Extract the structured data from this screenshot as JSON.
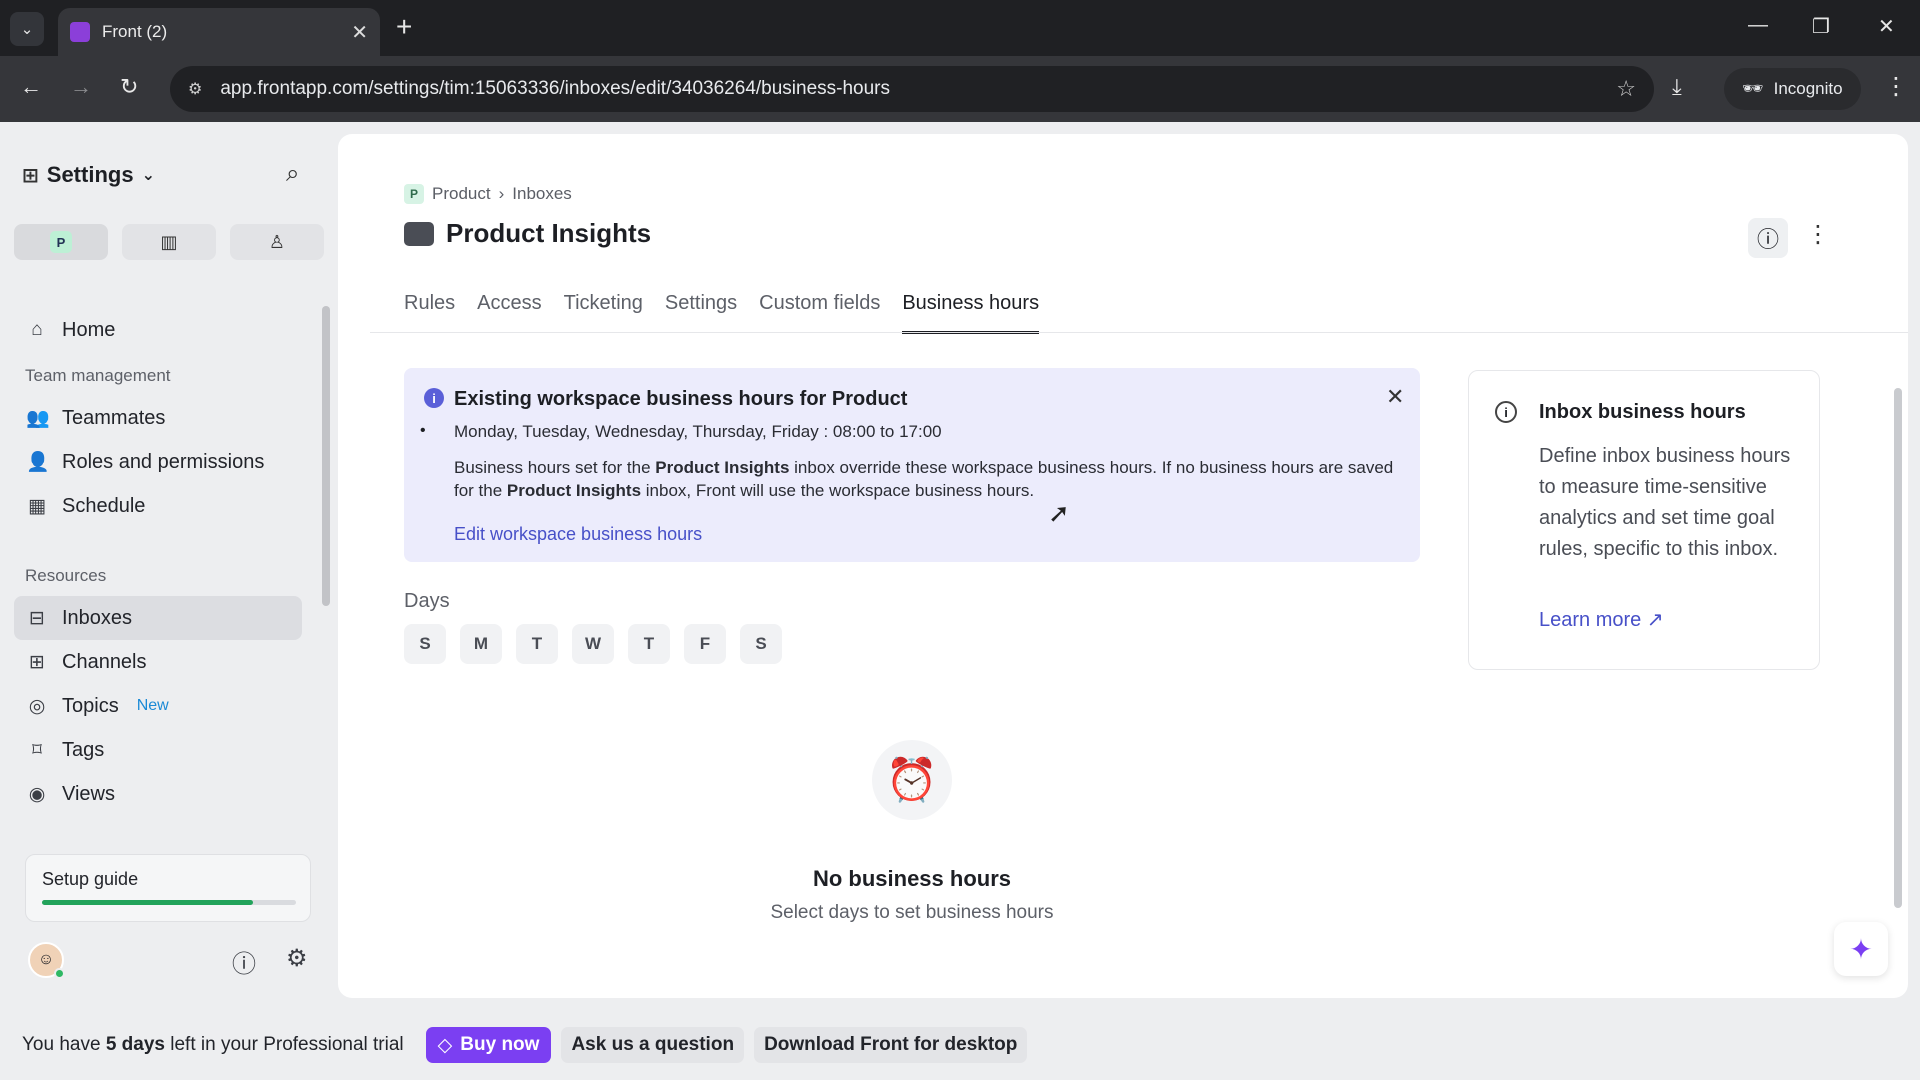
{
  "browser": {
    "tab_title": "Front (2)",
    "url": "app.frontapp.com/settings/tim:15063336/inboxes/edit/34036264/business-hours",
    "incognito_label": "Incognito"
  },
  "sidebar": {
    "header": "Settings",
    "workspace_badge": "P",
    "home": "Home",
    "team_section": "Team management",
    "team_items": [
      "Teammates",
      "Roles and permissions",
      "Schedule"
    ],
    "resources_section": "Resources",
    "resource_items": [
      "Inboxes",
      "Channels",
      "Topics",
      "Tags",
      "Views"
    ],
    "topics_badge": "New",
    "setup_guide": "Setup guide",
    "setup_progress": 0.83
  },
  "page": {
    "breadcrumb_badge": "P",
    "breadcrumb": [
      "Product",
      "Inboxes"
    ],
    "title": "Product Insights",
    "tabs": [
      "Rules",
      "Access",
      "Ticketing",
      "Settings",
      "Custom fields",
      "Business hours"
    ],
    "active_tab": "Business hours"
  },
  "banner": {
    "title": "Existing workspace business hours for Product",
    "hours": "Monday, Tuesday, Wednesday, Thursday, Friday : 08:00 to 17:00",
    "desc_1": "Business hours set for the ",
    "desc_bold_1": "Product Insights",
    "desc_2": " inbox override these workspace business hours. If no business hours are saved for the ",
    "desc_bold_2": "Product Insights",
    "desc_3": " inbox, Front will use the workspace business hours.",
    "link": "Edit workspace business hours"
  },
  "days": {
    "label": "Days",
    "items": [
      "S",
      "M",
      "T",
      "W",
      "T",
      "F",
      "S"
    ]
  },
  "empty_state": {
    "title": "No business hours",
    "subtitle": "Select days to set business hours"
  },
  "side_card": {
    "title": "Inbox business hours",
    "body": "Define inbox business hours to measure time-sensitive analytics and set time goal rules, specific to this inbox.",
    "link": "Learn more"
  },
  "trial_bar": {
    "text_1": "You have ",
    "text_bold": "5 days",
    "text_2": " left in your Professional trial",
    "buy_label": "Buy now",
    "ask_label": "Ask us a question",
    "download_label": "Download Front for desktop"
  },
  "colors": {
    "accent": "#7b3ff2",
    "link": "#4750c8",
    "banner_bg": "#ececfc",
    "progress": "#22a35b"
  }
}
